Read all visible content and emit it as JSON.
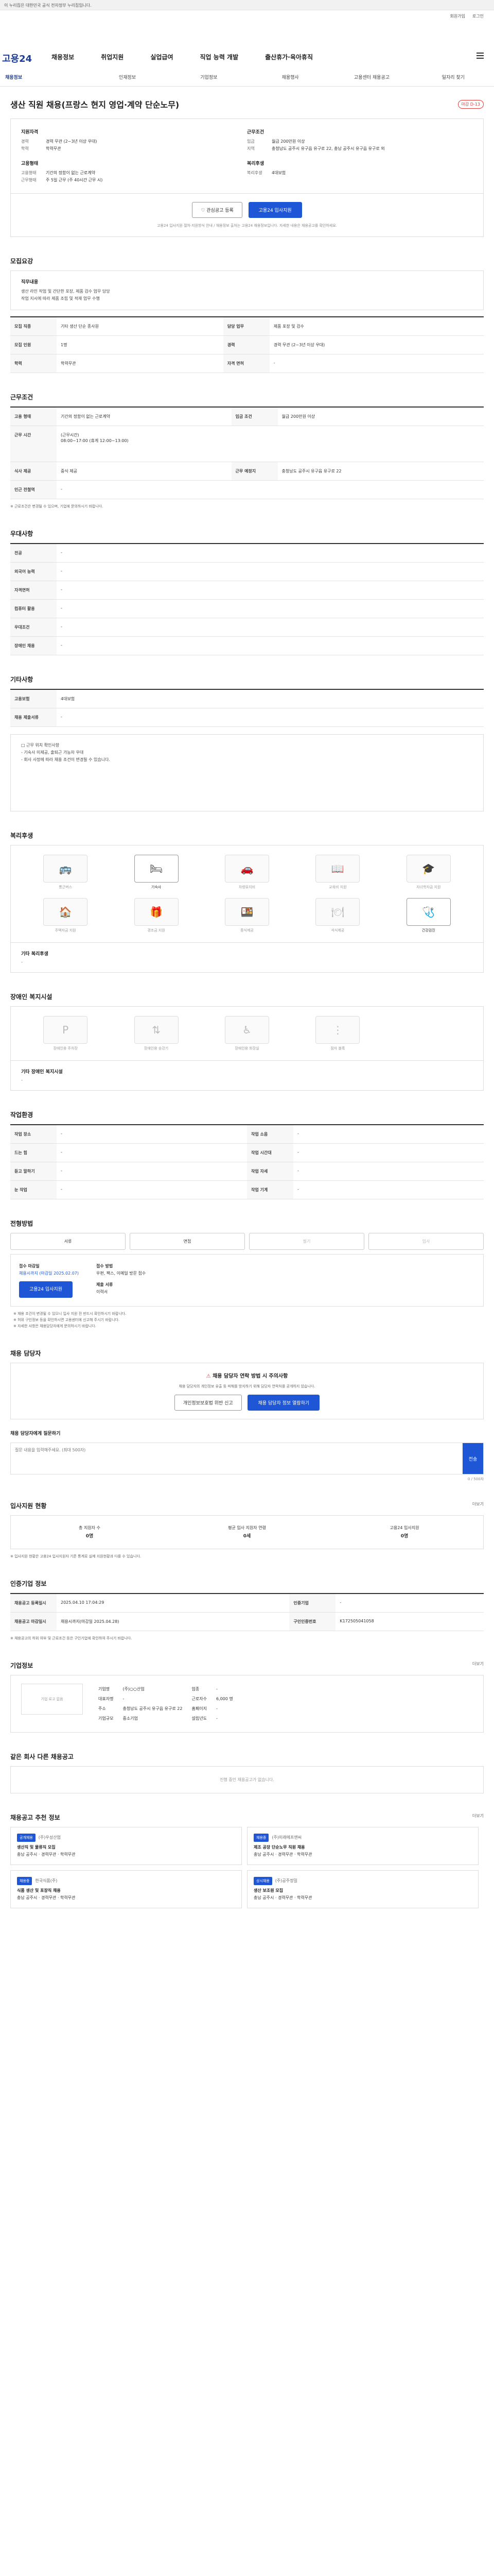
{
  "gov_bar": "이 누리집은 대한민국 공식 전자정부 누리집입니다.",
  "util": {
    "join": "회원가입",
    "login": "로그인",
    "logo": "고용24"
  },
  "gnb": [
    "채용정보",
    "취업지원",
    "실업급여",
    "직업 능력 개발",
    "출산휴가·육아휴직"
  ],
  "lnb": [
    "채용정보",
    "인재정보",
    "기업정보",
    "채용행사",
    "고용센터 채용공고",
    "일자리 찾기"
  ],
  "title": "생산 직원 채용(프랑스 현지 영업·계약 단순노무)",
  "title_badge": "마감 D-13",
  "summary": {
    "left_h": "지원자격",
    "left_rows": [
      [
        "경력",
        "경력 무관 (2~3년 이상 우대)"
      ],
      [
        "학력",
        "학력무관"
      ]
    ],
    "left_h2": "고용형태",
    "left_rows2": [
      [
        "고용형태",
        "기간의 정함이 없는 근로계약"
      ],
      [
        "근무형태",
        "주 5일 근무 (주 40시간 근무 시)"
      ]
    ],
    "right_h": "근무조건",
    "right_rows": [
      [
        "임금",
        "월급 200만원 이상"
      ],
      [
        "지역",
        "충청남도 공주시 유구읍 유구로 22, 충남 공주시 유구읍 유구로 외"
      ]
    ],
    "right_h2": "복리후생",
    "right_rows2": [
      [
        "복리후생",
        "4대보험"
      ]
    ]
  },
  "actions": {
    "save": "관심공고 등록",
    "apply": "고용24 입사지원",
    "note": "고용24 입사지원 절차·지원방식 안내 / 채용정보 출처는 고용24 채용정보입니다. 자세한 내용은 채용공고를 확인하세요."
  },
  "sec_job": {
    "h": "모집요강",
    "lbl": "직무내용",
    "desc": "생산 라인 작업 및 간단한 포장, 제품 검수 업무 담당\n작업 지시에 따라 제품 조립 및 적재 업무 수행"
  },
  "job_table": [
    [
      "모집 직종",
      "기타 생산 단순 종사원"
    ],
    [
      "담당 업무",
      "제품 포장 및 검수"
    ],
    [
      "모집 인원",
      "1명"
    ],
    [
      "경력",
      "경력 무관 (2~3년 이상 우대)"
    ],
    [
      "학력",
      "학력무관"
    ],
    [
      "자격 면허",
      "-"
    ]
  ],
  "work": {
    "h": "근무조건",
    "rows": [
      [
        "고용 형태",
        "기간의 정함이 없는 근로계약"
      ],
      [
        "임금 조건",
        "월급 200만원 이상"
      ],
      [
        "근무 시간",
        "(근무시간)\n08:00~17:00 (휴게 12:00~13:00)"
      ],
      [
        "식사 제공",
        "중식 제공"
      ],
      [
        "근무 예정지",
        "충청남도 공주시 유구읍 유구로 22"
      ],
      [
        "인근 전철역",
        "-"
      ]
    ],
    "note": "※ 근로조건은 변경될 수 있으며, 기업에 문의하시기 바랍니다."
  },
  "prefer": {
    "h": "우대사항",
    "rows": [
      [
        "전공",
        "-"
      ],
      [
        "외국어 능력",
        "-"
      ],
      [
        "자격면허",
        "-"
      ],
      [
        "컴퓨터 활용",
        "-"
      ],
      [
        "우대조건",
        "-"
      ],
      [
        "장애인 채용",
        "-"
      ]
    ]
  },
  "other": {
    "h": "기타사항",
    "rows": [
      [
        "고용보험",
        "4대보험"
      ],
      [
        "채용 제출서류",
        "-"
      ]
    ],
    "lines": [
      "□ 근무 위치 확인사항",
      "  - 기숙사 미제공, 출퇴근 가능자 우대",
      "  - 회사 사정에 따라 채용 조건이 변경될 수 있습니다."
    ]
  },
  "welfare": {
    "h": "복리후생",
    "items": [
      "통근버스",
      "기숙사",
      "차량유지비",
      "교육비 지원",
      "자녀학자금 지원",
      "주택자금 지원",
      "경조금 지원",
      "중식제공",
      "석식제공",
      "건강검진"
    ],
    "on": [
      1,
      9
    ],
    "etc_label": "기타 복리후생",
    "etc_value": "-"
  },
  "disabled": {
    "h": "장애인 복지시설",
    "items": [
      "장애인용 주차장",
      "장애인용 승강기",
      "장애인용 화장실",
      "점자 블록"
    ],
    "etc_label": "기타 장애인 복지시설",
    "etc_value": "-"
  },
  "env": {
    "h": "작업환경",
    "rows": [
      [
        "작업 장소",
        "-",
        "작업 소음",
        "-"
      ],
      [
        "드는 힘",
        "-",
        "작업 시간대",
        "-"
      ],
      [
        "듣고 말하기",
        "-",
        "작업 자세",
        "-"
      ],
      [
        "눈 작업",
        "-",
        "작업 기계",
        "-"
      ]
    ]
  },
  "select": {
    "h": "전형방법",
    "steps": [
      "서류",
      "면접",
      "필기",
      "입사"
    ],
    "apply_k": "접수 마감일",
    "apply_v": "채용시까지 (마감일 2025.02.07)",
    "method_k": "접수 방법",
    "method_v": "우편, 팩스, 이메일 방문 접수",
    "docs_k": "제출 서류",
    "docs_v": "이력서",
    "btn": "고용24 입사지원",
    "notes": [
      "※ 채용 조건이 변경될 수 있으니 입사 지원 전 반드시 확인하시기 바랍니다.",
      "※ 허위 구인정보 등을 확인하시면 고용센터에 신고해 주시기 바랍니다.",
      "※ 자세한 사항은 채용담당자에게 문의하시기 바랍니다."
    ]
  },
  "contact": {
    "h": "채용 담당자",
    "warn_t": "채용 담당자 연락 방법 시 주의사항",
    "warn_p": "채용 담당자의 개인정보 유출 등 피해를 방지하기 위해 담당자 연락처를 공개하지 않습니다.",
    "btns": [
      "개인정보보호법 위반 신고",
      "채용 담당자 정보 열람하기"
    ],
    "inq_label": "채용 담당자에게 질문하기",
    "inq_placeholder": "질문 내용을 입력해주세요. (최대 500자)",
    "inq_count": "0 / 500자",
    "inq_btn": "전송"
  },
  "status": {
    "h": "입사지원 현황",
    "more": "더보기",
    "items": [
      [
        "총 지원자 수",
        "0명"
      ],
      [
        "평균 입사 지원자 연령",
        "0세"
      ],
      [
        "고용24 입사지원",
        "0명"
      ]
    ],
    "note": "※ 입사지원 현황은 고용24 입사지원자 기준 통계로 실제 지원현황과 다를 수 있습니다."
  },
  "reg": {
    "h": "인증기업 정보",
    "rows": [
      [
        "채용공고 등록일시",
        "2025.04.10 17:04:29",
        "인증기업",
        "-"
      ],
      [
        "채용공고 마감일시",
        "채용시까지(마감일 2025.04.28)",
        "구인인증번호",
        "K172505041058"
      ]
    ],
    "note": "※ 채용공고의 허위 여부 및 근로조건 등은 구인기업에 확인하여 주시기 바랍니다."
  },
  "company": {
    "h": "기업정보",
    "more": "더보기",
    "logo": "기업 로고 없음",
    "rows": [
      [
        "기업명",
        "(주)○○산업",
        "업종",
        "-"
      ],
      [
        "대표자명",
        "-",
        "근로자수",
        "6,000 명"
      ],
      [
        "주소",
        "충청남도 공주시 유구읍 유구로 22",
        "홈페이지",
        "-"
      ],
      [
        "기업규모",
        "중소기업",
        "설립년도",
        "-"
      ]
    ]
  },
  "same": {
    "h": "같은 회사 다른 채용공고",
    "empty": "진행 중인 채용공고가 없습니다."
  },
  "similar": {
    "h": "채용공고 추천 정보",
    "more": "더보기",
    "jobs": [
      {
        "co": "(주)우성산업",
        "tag": "공개채용",
        "title": "생산직 및 물류직 모집",
        "info": "충남 공주시 · 경력무관 · 학력무관"
      },
      {
        "co": "(주)미래에프앤씨",
        "tag": "채용중",
        "title": "제조 공장 단순노무 직원 채용",
        "info": "충남 공주시 · 경력무관 · 학력무관"
      },
      {
        "co": "한국식품(주)",
        "tag": "채용중",
        "title": "식품 생산 및 포장직 채용",
        "info": "충남 공주시 · 경력무관 · 학력무관"
      },
      {
        "co": "(주)공주정밀",
        "tag": "상시채용",
        "title": "생산 보조원 모집",
        "info": "충남 공주시 · 경력무관 · 학력무관"
      }
    ]
  }
}
